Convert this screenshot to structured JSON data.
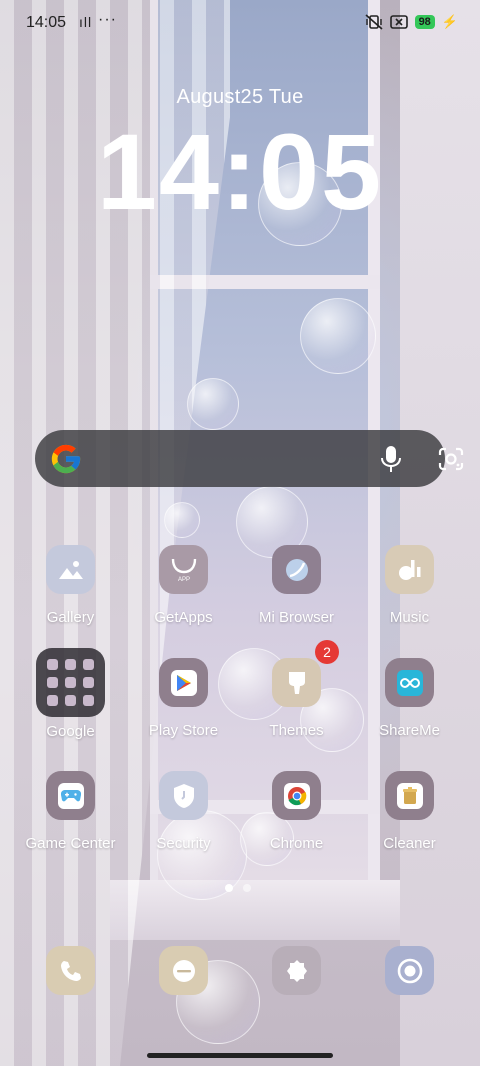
{
  "status_bar": {
    "time": "14:05",
    "signal_text": "ıll",
    "more_text": "···",
    "battery_level": "98",
    "battery_color": "#34c759"
  },
  "lock_widget": {
    "date": "August25  Tue",
    "clock": "14:05"
  },
  "search_bar": {
    "icons": [
      "google-g-icon",
      "microphone-icon",
      "google-lens-icon"
    ]
  },
  "apps": [
    {
      "label": "Gallery",
      "icon": "gallery-icon"
    },
    {
      "label": "GetApps",
      "icon": "getapps-icon"
    },
    {
      "label": "Mi Browser",
      "icon": "browser-icon"
    },
    {
      "label": "Music",
      "icon": "music-icon"
    },
    {
      "label": "Google",
      "icon": "folder-icon"
    },
    {
      "label": "Play Store",
      "icon": "play-store-icon"
    },
    {
      "label": "Themes",
      "icon": "themes-icon",
      "badge": "2"
    },
    {
      "label": "ShareMe",
      "icon": "shareme-icon"
    },
    {
      "label": "Game Center",
      "icon": "game-center-icon"
    },
    {
      "label": "Security",
      "icon": "security-icon"
    },
    {
      "label": "Chrome",
      "icon": "chrome-icon"
    },
    {
      "label": "Cleaner",
      "icon": "cleaner-icon"
    }
  ],
  "page_indicator": {
    "pages": 2,
    "current": 1
  },
  "dock": [
    "phone-icon",
    "messages-icon",
    "settings-icon",
    "camera-icon"
  ]
}
